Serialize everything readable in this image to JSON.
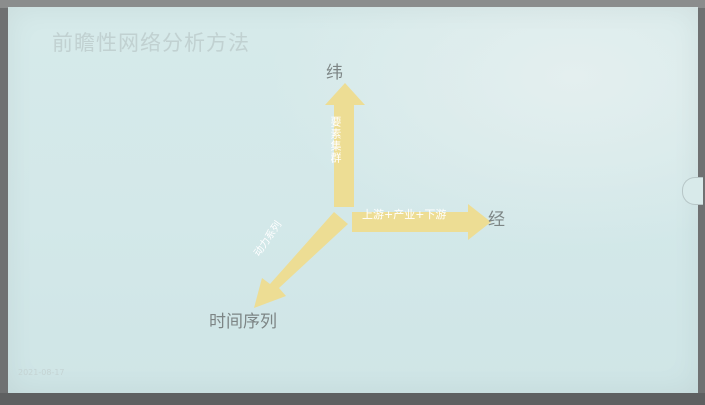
{
  "slide": {
    "title": "前瞻性网络分析方法",
    "date": "2021-08-17"
  },
  "diagram": {
    "axis_up_label": "纬",
    "axis_right_label": "经",
    "axis_diag_label": "时间序列",
    "arrow_up_text": "要素集群",
    "arrow_right_text": "上游+产业+下游",
    "arrow_diag_text": "动力系列"
  },
  "colors": {
    "arrow_fill": "#eedc8f",
    "slide_background": "#d4e9e9",
    "label_text": "#7d8585"
  }
}
